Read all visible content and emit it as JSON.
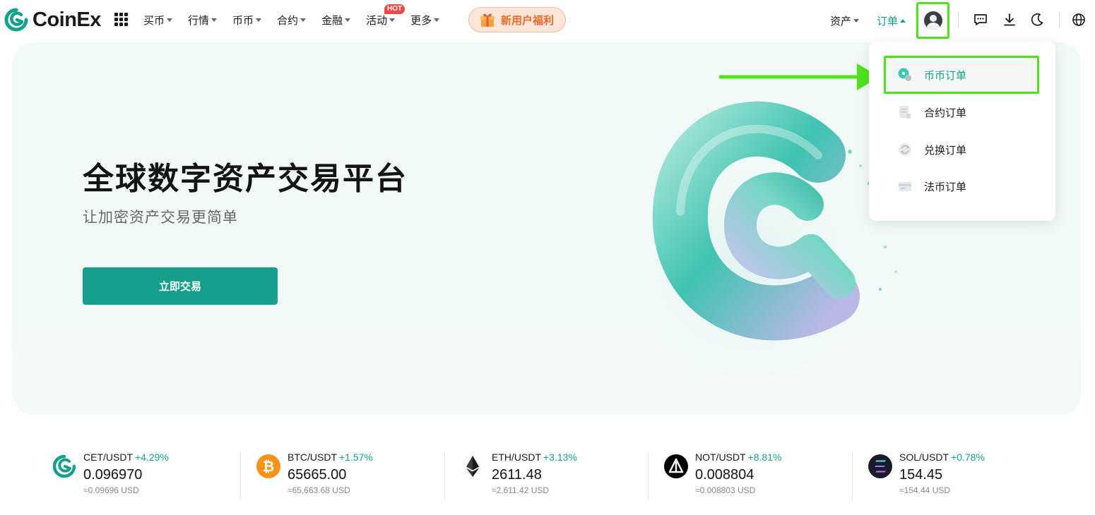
{
  "brand": {
    "name": "CoinEx",
    "accent": "#14a08a",
    "highlight": "#4fe31c"
  },
  "nav": [
    {
      "label": "买币",
      "has_caret": true
    },
    {
      "label": "行情",
      "has_caret": true
    },
    {
      "label": "币币",
      "has_caret": true
    },
    {
      "label": "合约",
      "has_caret": true
    },
    {
      "label": "金融",
      "has_caret": true
    },
    {
      "label": "活动",
      "has_caret": true,
      "badge": "HOT"
    },
    {
      "label": "更多",
      "has_caret": true
    }
  ],
  "promo": {
    "label": "新用户福利",
    "icon": "gift-icon"
  },
  "header_right": {
    "assets_label": "资产",
    "orders_label": "订单",
    "avatar_icon": "user-avatar-icon",
    "icons": [
      "chat-icon",
      "download-icon",
      "moon-icon",
      "globe-icon"
    ]
  },
  "orders_menu": {
    "items": [
      {
        "label": "币币订单",
        "icon": "spot-order-icon",
        "selected": true
      },
      {
        "label": "合约订单",
        "icon": "futures-order-icon",
        "selected": false
      },
      {
        "label": "兑换订单",
        "icon": "swap-order-icon",
        "selected": false
      },
      {
        "label": "法币订单",
        "icon": "fiat-order-icon",
        "selected": false
      }
    ]
  },
  "hero": {
    "title": "全球数字资产交易平台",
    "subtitle": "让加密资产交易更简单",
    "cta": "立即交易"
  },
  "tickers": [
    {
      "pair": "CET/USDT",
      "change": "+4.29%",
      "price": "0.096970",
      "usd": "≈0.09696 USD",
      "icon": "cet-coin-icon",
      "icon_color": "#14a08a"
    },
    {
      "pair": "BTC/USDT",
      "change": "+1.57%",
      "price": "65665.00",
      "usd": "≈65,663.68 USD",
      "icon": "btc-coin-icon",
      "icon_color": "#f7931a"
    },
    {
      "pair": "ETH/USDT",
      "change": "+3.13%",
      "price": "2611.48",
      "usd": "≈2,611.42 USD",
      "icon": "eth-coin-icon",
      "icon_color": "#3c3c3d"
    },
    {
      "pair": "NOT/USDT",
      "change": "+8.81%",
      "price": "0.008804",
      "usd": "≈0.008803 USD",
      "icon": "not-coin-icon",
      "icon_color": "#000000"
    },
    {
      "pair": "SOL/USDT",
      "change": "+0.78%",
      "price": "154.45",
      "usd": "≈154.44 USD",
      "icon": "sol-coin-icon",
      "icon_color": "#1a1a2e"
    }
  ]
}
